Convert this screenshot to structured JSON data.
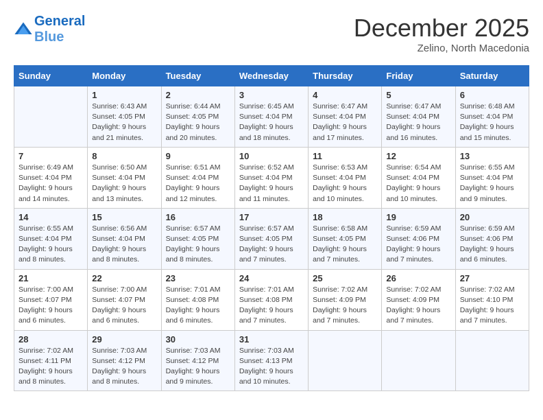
{
  "logo": {
    "line1": "General",
    "line2": "Blue"
  },
  "title": "December 2025",
  "location": "Zelino, North Macedonia",
  "weekdays": [
    "Sunday",
    "Monday",
    "Tuesday",
    "Wednesday",
    "Thursday",
    "Friday",
    "Saturday"
  ],
  "weeks": [
    [
      {
        "day": "",
        "info": ""
      },
      {
        "day": "1",
        "info": "Sunrise: 6:43 AM\nSunset: 4:05 PM\nDaylight: 9 hours\nand 21 minutes."
      },
      {
        "day": "2",
        "info": "Sunrise: 6:44 AM\nSunset: 4:05 PM\nDaylight: 9 hours\nand 20 minutes."
      },
      {
        "day": "3",
        "info": "Sunrise: 6:45 AM\nSunset: 4:04 PM\nDaylight: 9 hours\nand 18 minutes."
      },
      {
        "day": "4",
        "info": "Sunrise: 6:47 AM\nSunset: 4:04 PM\nDaylight: 9 hours\nand 17 minutes."
      },
      {
        "day": "5",
        "info": "Sunrise: 6:47 AM\nSunset: 4:04 PM\nDaylight: 9 hours\nand 16 minutes."
      },
      {
        "day": "6",
        "info": "Sunrise: 6:48 AM\nSunset: 4:04 PM\nDaylight: 9 hours\nand 15 minutes."
      }
    ],
    [
      {
        "day": "7",
        "info": "Sunrise: 6:49 AM\nSunset: 4:04 PM\nDaylight: 9 hours\nand 14 minutes."
      },
      {
        "day": "8",
        "info": "Sunrise: 6:50 AM\nSunset: 4:04 PM\nDaylight: 9 hours\nand 13 minutes."
      },
      {
        "day": "9",
        "info": "Sunrise: 6:51 AM\nSunset: 4:04 PM\nDaylight: 9 hours\nand 12 minutes."
      },
      {
        "day": "10",
        "info": "Sunrise: 6:52 AM\nSunset: 4:04 PM\nDaylight: 9 hours\nand 11 minutes."
      },
      {
        "day": "11",
        "info": "Sunrise: 6:53 AM\nSunset: 4:04 PM\nDaylight: 9 hours\nand 10 minutes."
      },
      {
        "day": "12",
        "info": "Sunrise: 6:54 AM\nSunset: 4:04 PM\nDaylight: 9 hours\nand 10 minutes."
      },
      {
        "day": "13",
        "info": "Sunrise: 6:55 AM\nSunset: 4:04 PM\nDaylight: 9 hours\nand 9 minutes."
      }
    ],
    [
      {
        "day": "14",
        "info": "Sunrise: 6:55 AM\nSunset: 4:04 PM\nDaylight: 9 hours\nand 8 minutes."
      },
      {
        "day": "15",
        "info": "Sunrise: 6:56 AM\nSunset: 4:04 PM\nDaylight: 9 hours\nand 8 minutes."
      },
      {
        "day": "16",
        "info": "Sunrise: 6:57 AM\nSunset: 4:05 PM\nDaylight: 9 hours\nand 8 minutes."
      },
      {
        "day": "17",
        "info": "Sunrise: 6:57 AM\nSunset: 4:05 PM\nDaylight: 9 hours\nand 7 minutes."
      },
      {
        "day": "18",
        "info": "Sunrise: 6:58 AM\nSunset: 4:05 PM\nDaylight: 9 hours\nand 7 minutes."
      },
      {
        "day": "19",
        "info": "Sunrise: 6:59 AM\nSunset: 4:06 PM\nDaylight: 9 hours\nand 7 minutes."
      },
      {
        "day": "20",
        "info": "Sunrise: 6:59 AM\nSunset: 4:06 PM\nDaylight: 9 hours\nand 6 minutes."
      }
    ],
    [
      {
        "day": "21",
        "info": "Sunrise: 7:00 AM\nSunset: 4:07 PM\nDaylight: 9 hours\nand 6 minutes."
      },
      {
        "day": "22",
        "info": "Sunrise: 7:00 AM\nSunset: 4:07 PM\nDaylight: 9 hours\nand 6 minutes."
      },
      {
        "day": "23",
        "info": "Sunrise: 7:01 AM\nSunset: 4:08 PM\nDaylight: 9 hours\nand 6 minutes."
      },
      {
        "day": "24",
        "info": "Sunrise: 7:01 AM\nSunset: 4:08 PM\nDaylight: 9 hours\nand 7 minutes."
      },
      {
        "day": "25",
        "info": "Sunrise: 7:02 AM\nSunset: 4:09 PM\nDaylight: 9 hours\nand 7 minutes."
      },
      {
        "day": "26",
        "info": "Sunrise: 7:02 AM\nSunset: 4:09 PM\nDaylight: 9 hours\nand 7 minutes."
      },
      {
        "day": "27",
        "info": "Sunrise: 7:02 AM\nSunset: 4:10 PM\nDaylight: 9 hours\nand 7 minutes."
      }
    ],
    [
      {
        "day": "28",
        "info": "Sunrise: 7:02 AM\nSunset: 4:11 PM\nDaylight: 9 hours\nand 8 minutes."
      },
      {
        "day": "29",
        "info": "Sunrise: 7:03 AM\nSunset: 4:12 PM\nDaylight: 9 hours\nand 8 minutes."
      },
      {
        "day": "30",
        "info": "Sunrise: 7:03 AM\nSunset: 4:12 PM\nDaylight: 9 hours\nand 9 minutes."
      },
      {
        "day": "31",
        "info": "Sunrise: 7:03 AM\nSunset: 4:13 PM\nDaylight: 9 hours\nand 10 minutes."
      },
      {
        "day": "",
        "info": ""
      },
      {
        "day": "",
        "info": ""
      },
      {
        "day": "",
        "info": ""
      }
    ]
  ]
}
